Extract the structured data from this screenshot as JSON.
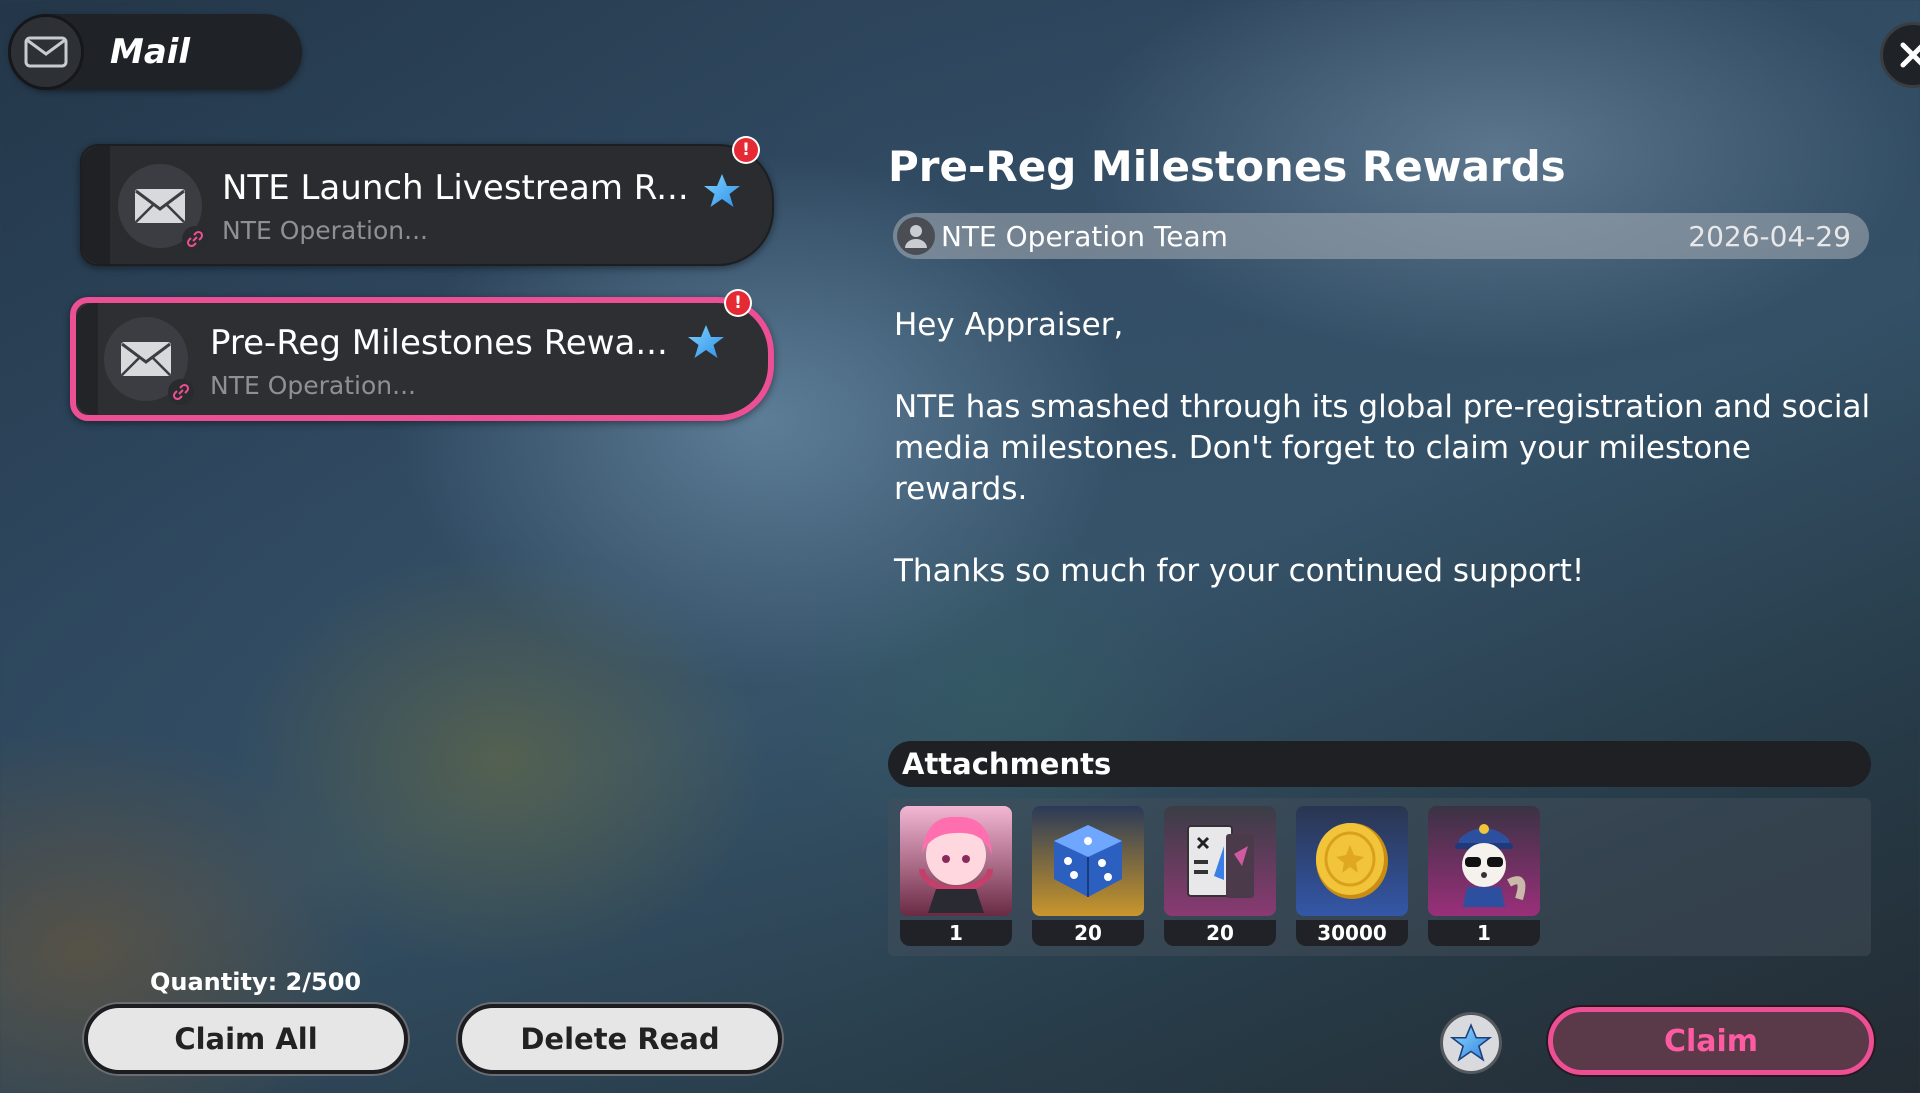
{
  "header": {
    "title": "Mail",
    "icon": "envelope-icon"
  },
  "mails": [
    {
      "title": "NTE Launch Livestream R...",
      "sender": "NTE Operation...",
      "starred": true,
      "unread": true,
      "alert": "!"
    },
    {
      "title": "Pre-Reg Milestones Rewa...",
      "sender": "NTE Operation...",
      "starred": true,
      "unread": true,
      "alert": "!",
      "selected": true
    }
  ],
  "footer": {
    "quantity": "Quantity: 2/500",
    "claim_all": "Claim All",
    "delete_read": "Delete Read"
  },
  "detail": {
    "title": "Pre-Reg Milestones Rewards",
    "sender": "NTE Operation Team",
    "date": "2026-04-29",
    "greeting": "Hey Appraiser,",
    "paragraph1": "NTE has smashed through its global pre-registration and social media milestones. Don't forget to claim your milestone rewards.",
    "paragraph2": "Thanks so much for your continued support!",
    "attachments_label": "Attachments",
    "attachments": [
      {
        "icon": "character-avatar-icon",
        "qty": "1",
        "frame": "#8a3a58"
      },
      {
        "icon": "dice-icon",
        "qty": "20",
        "frame": "#c9962b"
      },
      {
        "icon": "ticket-icon",
        "qty": "20",
        "frame": "#8a3a72"
      },
      {
        "icon": "gold-coin-icon",
        "qty": "30000",
        "frame": "#3457a8"
      },
      {
        "icon": "police-raccoon-icon",
        "qty": "1",
        "frame": "#9a2f7a"
      }
    ],
    "claim": "Claim"
  },
  "colors": {
    "accent": "#ec4f94",
    "alert": "#e62a34",
    "star": "#4fb7f5"
  }
}
